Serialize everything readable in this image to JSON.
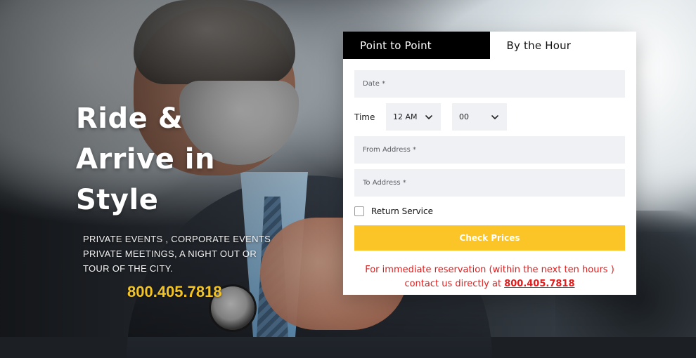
{
  "hero": {
    "headline_line1": "Ride &",
    "headline_line2": "Arrive in",
    "headline_line3": "Style",
    "subtitle_line1": "PRIVATE EVENTS , CORPORATE EVENTS",
    "subtitle_line2": "PRIVATE MEETINGS, A NIGHT OUT OR",
    "subtitle_line3": "TOUR OF THE CITY.",
    "phone": "800.405.7818"
  },
  "booking": {
    "tabs": [
      {
        "label": "Point to Point",
        "active": true
      },
      {
        "label": "By the Hour",
        "active": false
      }
    ],
    "date_placeholder": "Date *",
    "time_label": "Time",
    "hour_value": "12 AM",
    "minute_value": "00",
    "from_placeholder": "From Address *",
    "to_placeholder": "To Address *",
    "return_service_label": "Return Service",
    "submit_label": "Check Prices",
    "notice_line1": "For immediate reservation (within the next ten hours )",
    "notice_line2_prefix": "contact us directly at",
    "notice_phone": "800.405.7818"
  },
  "colors": {
    "accent_yellow": "#FBC427",
    "notice_red": "#E21B1B",
    "active_tab_bg": "#000000"
  },
  "icons": {
    "select_chevron": "chevron-down-icon"
  }
}
